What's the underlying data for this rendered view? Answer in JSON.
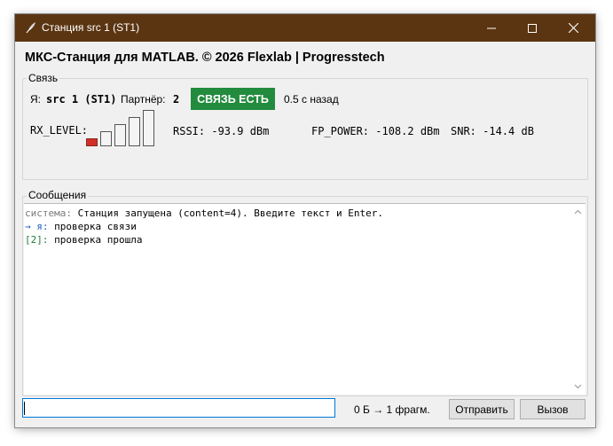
{
  "window": {
    "title": "Станция src 1 (ST1)",
    "titlebar_color": "#5b3512"
  },
  "app_title": "МКС-Станция для MATLAB. © 2026 Flexlab | Progresstech",
  "link": {
    "legend": "Связь",
    "me_label": "Я:",
    "me_value": "src 1 (ST1)",
    "partner_label": "Партнёр:",
    "partner_value": "2",
    "status": "СВЯЗЬ ЕСТЬ",
    "status_color": "#238b3e",
    "ago": "0.5 с назад",
    "rx_label": "RX_LEVEL:",
    "rx_level_bars": 1,
    "rx_level_bars_total": 5,
    "rx_on_color": "#d0302a",
    "rssi": "RSSI: -93.9 dBm",
    "fp_power": "FP_POWER: -108.2 dBm",
    "snr": "SNR: -14.4 dB"
  },
  "messages": {
    "legend": "Сообщения",
    "lines": [
      {
        "prefix": "система:",
        "prefix_color": "#7a7a7a",
        "text": " Станция запущена (content=4). Введите текст и Enter."
      },
      {
        "prefix": "→ я:",
        "prefix_color": "#1f5fbf",
        "text": " проверка связи"
      },
      {
        "prefix": "[2]:",
        "prefix_color": "#1f7a3a",
        "text": " проверка прошла"
      }
    ]
  },
  "input": {
    "value": "",
    "placeholder": ""
  },
  "bytes_info": "0 Б → 1 фрагм.",
  "buttons": {
    "send": "Отправить",
    "call": "Вызов"
  }
}
